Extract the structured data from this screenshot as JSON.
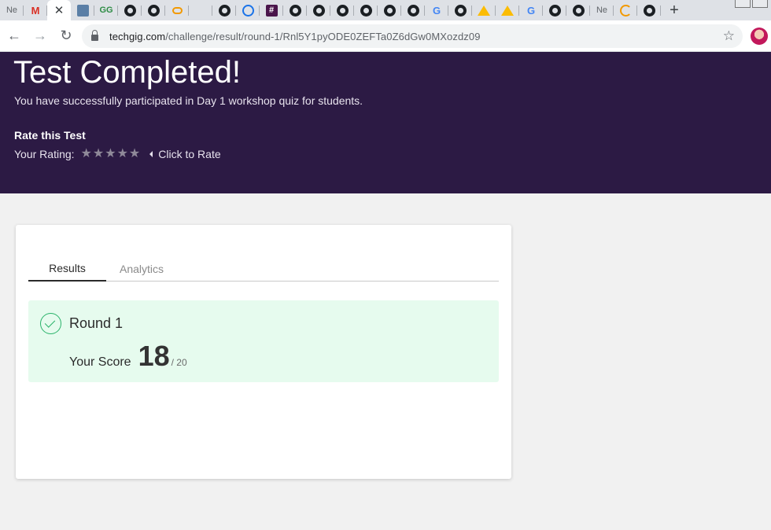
{
  "browser": {
    "tabs": [
      {
        "icon": "ne-icon",
        "text": "Ne"
      },
      {
        "icon": "gmail-icon",
        "text": "M"
      },
      {
        "icon": "close-icon",
        "text": "✕",
        "active": true
      },
      {
        "icon": "techgig-icon",
        "text": ""
      },
      {
        "icon": "geeksforgeeks-icon",
        "text": "GG"
      },
      {
        "icon": "github-icon",
        "text": ""
      },
      {
        "icon": "github-icon",
        "text": ""
      },
      {
        "icon": "codechef-icon",
        "text": ""
      },
      {
        "icon": "blank-icon",
        "text": ""
      },
      {
        "icon": "github-icon",
        "text": ""
      },
      {
        "icon": "history-icon",
        "text": ""
      },
      {
        "icon": "slack-icon",
        "text": "#"
      },
      {
        "icon": "github-icon",
        "text": ""
      },
      {
        "icon": "github-icon",
        "text": ""
      },
      {
        "icon": "github-icon",
        "text": ""
      },
      {
        "icon": "github-icon",
        "text": ""
      },
      {
        "icon": "github-icon",
        "text": ""
      },
      {
        "icon": "github-icon",
        "text": ""
      },
      {
        "icon": "google-icon",
        "text": "G"
      },
      {
        "icon": "github-icon",
        "text": ""
      },
      {
        "icon": "google-drive-icon",
        "text": ""
      },
      {
        "icon": "google-drive-icon",
        "text": ""
      },
      {
        "icon": "google-icon",
        "text": "G"
      },
      {
        "icon": "github-icon",
        "text": ""
      },
      {
        "icon": "github-icon",
        "text": ""
      },
      {
        "icon": "ne-icon",
        "text": "Ne"
      },
      {
        "icon": "orange-c-icon",
        "text": ""
      },
      {
        "icon": "github-icon",
        "text": ""
      }
    ],
    "new_tab": "+",
    "url_host": "techgig.com",
    "url_path": "/challenge/result/round-1/Rnl5Y1pyODE0ZEFTa0Z6dGw0MXozdz09"
  },
  "hero": {
    "title": "Test Completed!",
    "subtitle": "You have successfully participated in Day 1 workshop quiz for students.",
    "rate_title": "Rate this Test",
    "rating_label": "Your Rating:",
    "rating_stars": 5,
    "rating_value": 0,
    "click_to_rate": "Click to Rate"
  },
  "card": {
    "tabs": [
      {
        "label": "Results",
        "active": true
      },
      {
        "label": "Analytics",
        "active": false
      }
    ],
    "result": {
      "round": "Round 1",
      "score_label": "Your Score",
      "score": "18",
      "total": "/ 20"
    }
  },
  "colors": {
    "hero_bg": "#2c1a44",
    "result_bg": "#e6fbee",
    "check": "#29b36a"
  }
}
